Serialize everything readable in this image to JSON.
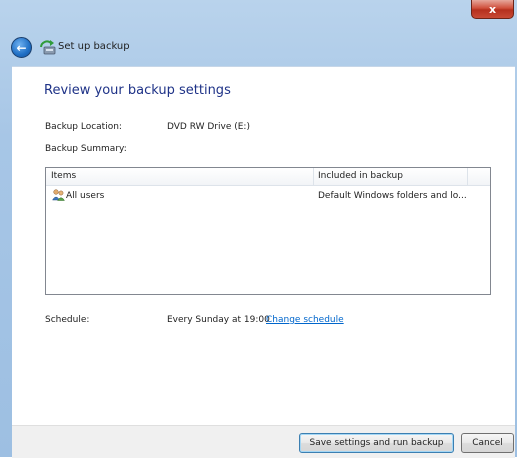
{
  "window": {
    "title": "Set up backup",
    "close_glyph": "x"
  },
  "page": {
    "heading": "Review your backup settings"
  },
  "location": {
    "label": "Backup Location:",
    "value": "DVD RW Drive (E:)"
  },
  "summary": {
    "label": "Backup Summary:",
    "columns": [
      "Items",
      "Included in backup"
    ],
    "rows": [
      {
        "item": "All users",
        "included": "Default Windows folders and lo...",
        "icon": "users-icon"
      }
    ]
  },
  "schedule": {
    "label": "Schedule:",
    "value": "Every Sunday at 19:00",
    "change_link": "Change schedule"
  },
  "footer": {
    "save_button": "Save settings and run backup",
    "cancel_button": "Cancel"
  },
  "icons": [
    "back-arrow-icon",
    "backup-icon",
    "users-icon",
    "close-icon"
  ],
  "colors": {
    "heading": "#1e3287",
    "link": "#0066cc",
    "close": "#c84a36",
    "frame": "#a7c6e6"
  }
}
